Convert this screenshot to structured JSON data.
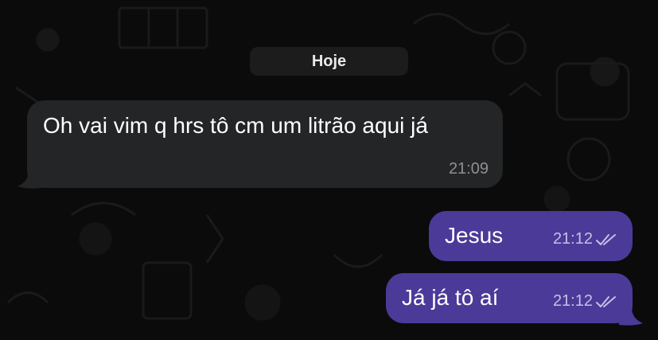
{
  "conversation": {
    "date_divider": "Hoje",
    "messages": [
      {
        "direction": "incoming",
        "text": "Oh vai vim q hrs tô cm um litrão aqui já",
        "time": "21:09"
      },
      {
        "direction": "outgoing",
        "text": "Jesus",
        "time": "21:12",
        "status_icon": "double-check-icon"
      },
      {
        "direction": "outgoing",
        "text": "Já já tô aí",
        "time": "21:12",
        "status_icon": "double-check-icon"
      }
    ]
  },
  "colors": {
    "background": "#0b0b0b",
    "incoming_bubble": "#232526",
    "outgoing_bubble": "#4b3a98",
    "date_chip": "#1c1c1d"
  }
}
